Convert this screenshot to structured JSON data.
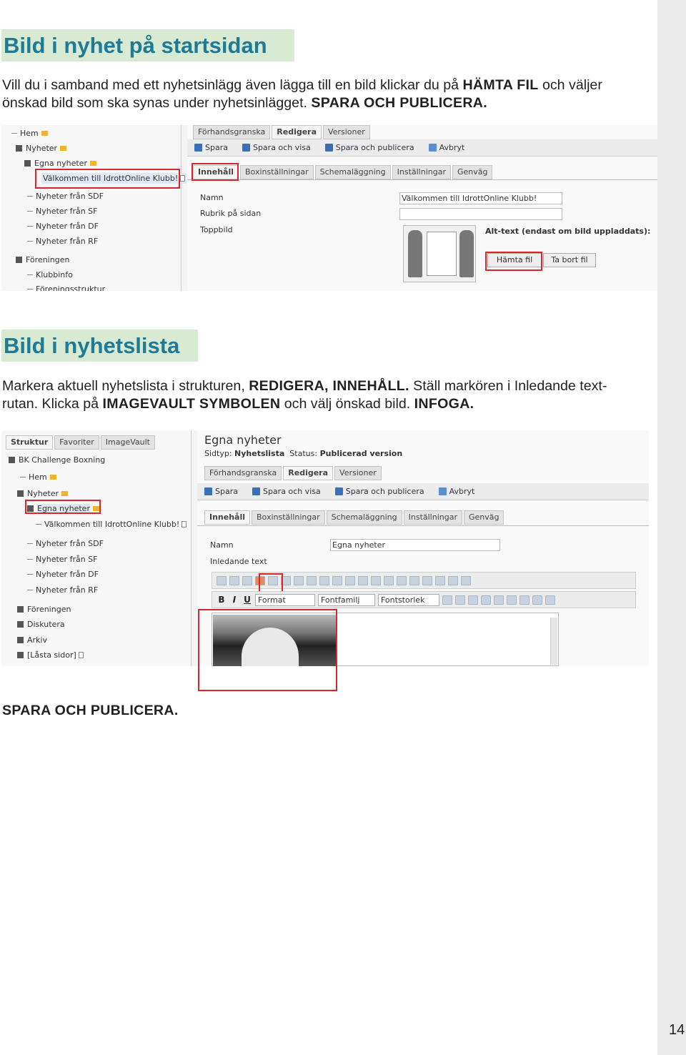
{
  "section1": {
    "heading": "Bild i nyhet på startsidan",
    "para_l1_a": "Vill du i samband med ett nyhetsinlägg även lägga till en bild klickar du på ",
    "para_l1_b": "HÄMTA FIL",
    "para_l1_c": " och väljer",
    "para_l2_a": "önskad bild som ska synas under nyhetsinlägget. ",
    "para_l2_b": "SPARA OCH PUBLICERA."
  },
  "screenshot1": {
    "tree": {
      "home": "Hem",
      "news": "Nyheter",
      "own_news": "Egna nyheter",
      "welcome": "Välkommen till IdrottOnline Klubb!",
      "from_sdf": "Nyheter från SDF",
      "from_sf": "Nyheter från SF",
      "from_df": "Nyheter från DF",
      "from_rf": "Nyheter från RF",
      "club": "Föreningen",
      "clubinfo": "Klubbinfo",
      "structure": "Föreningsstruktur"
    },
    "tabs_top": [
      "Förhandsgranska",
      "Redigera",
      "Versioner"
    ],
    "toolbar": {
      "save": "Spara",
      "save_view": "Spara och visa",
      "save_publish": "Spara och publicera",
      "cancel": "Avbryt"
    },
    "tabs_sub": [
      "Innehåll",
      "Boxinställningar",
      "Schemaläggning",
      "Inställningar",
      "Genväg"
    ],
    "fields": {
      "name_label": "Namn",
      "heading_label": "Rubrik på sidan",
      "image_label": "Toppbild",
      "name_value": "Välkommen till IdrottOnline Klubb!",
      "alt_label": "Alt-text (endast om bild uppladdats):",
      "fetch_button": "Hämta fil",
      "remove_button": "Ta bort fil"
    }
  },
  "section2": {
    "heading": "Bild i nyhetslista",
    "para_l1_a": "Markera aktuell nyhetslista i strukturen, ",
    "para_l1_b": "REDIGERA, INNEHÅLL.",
    "para_l1_c": " Ställ markören i Inledande text-",
    "para_l2_a": "rutan. Klicka på ",
    "para_l2_b": "IMAGEVAULT SYMBOLEN",
    "para_l2_c": " och välj önskad bild. ",
    "para_l2_d": "INFOGA."
  },
  "screenshot2": {
    "tree_tabs": [
      "Struktur",
      "Favoriter",
      "ImageVault"
    ],
    "tree": {
      "root": "BK Challenge   Boxning",
      "home": "Hem",
      "news": "Nyheter",
      "own_news": "Egna nyheter",
      "welcome": "Välkommen till IdrottOnline Klubb!",
      "from_sdf": "Nyheter från SDF",
      "from_sf": "Nyheter från SF",
      "from_df": "Nyheter från DF",
      "from_rf": "Nyheter från RF",
      "club": "Föreningen",
      "discuss": "Diskutera",
      "archive": "Arkiv",
      "locked": "[Låsta sidor]"
    },
    "page_title": "Egna nyheter",
    "page_type_label": "Sidtyp:",
    "page_type_value": "Nyhetslista",
    "status_label": "Status:",
    "status_value": "Publicerad version",
    "tabs_top": [
      "Förhandsgranska",
      "Redigera",
      "Versioner"
    ],
    "toolbar": {
      "save": "Spara",
      "save_view": "Spara och visa",
      "save_publish": "Spara och publicera",
      "cancel": "Avbryt"
    },
    "tabs_sub": [
      "Innehåll",
      "Boxinställningar",
      "Schemaläggning",
      "Inställningar",
      "Genväg"
    ],
    "name_label": "Namn",
    "name_value": "Egna nyheter",
    "intro_label": "Inledande text",
    "format_select": "Format",
    "font_select": "Fontfamilj",
    "size_select": "Fontstorlek",
    "bold": "B",
    "italic": "I",
    "underline": "U"
  },
  "final_text": "SPARA OCH PUBLICERA.",
  "page_number": "14"
}
